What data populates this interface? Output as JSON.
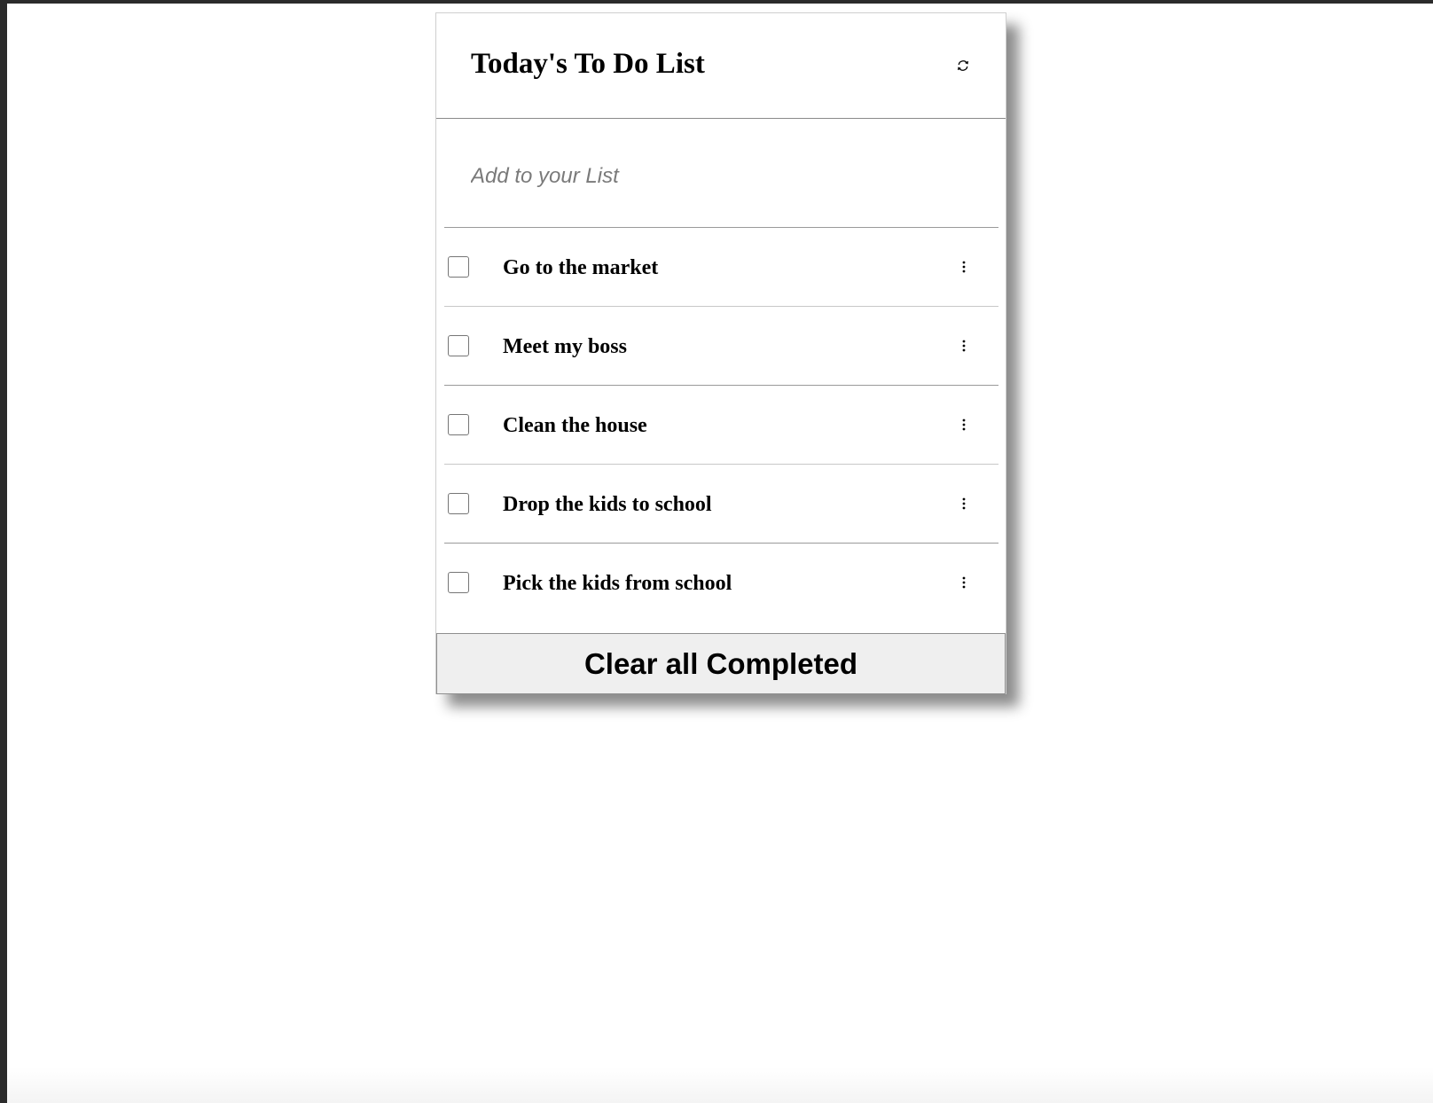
{
  "header": {
    "title": "Today's To Do List",
    "refresh_icon": "refresh-icon"
  },
  "add_input": {
    "placeholder": "Add to your List",
    "value": ""
  },
  "tasks": [
    {
      "label": "Go to the market",
      "checked": false,
      "menu_icon": "more-vertical-icon"
    },
    {
      "label": "Meet my boss",
      "checked": false,
      "menu_icon": "more-vertical-icon"
    },
    {
      "label": "Clean the house",
      "checked": false,
      "menu_icon": "more-vertical-icon"
    },
    {
      "label": "Drop the kids to school",
      "checked": false,
      "menu_icon": "more-vertical-icon"
    },
    {
      "label": "Pick the kids from school",
      "checked": false,
      "menu_icon": "more-vertical-icon"
    }
  ],
  "footer": {
    "clear_label": "Clear all Completed"
  }
}
